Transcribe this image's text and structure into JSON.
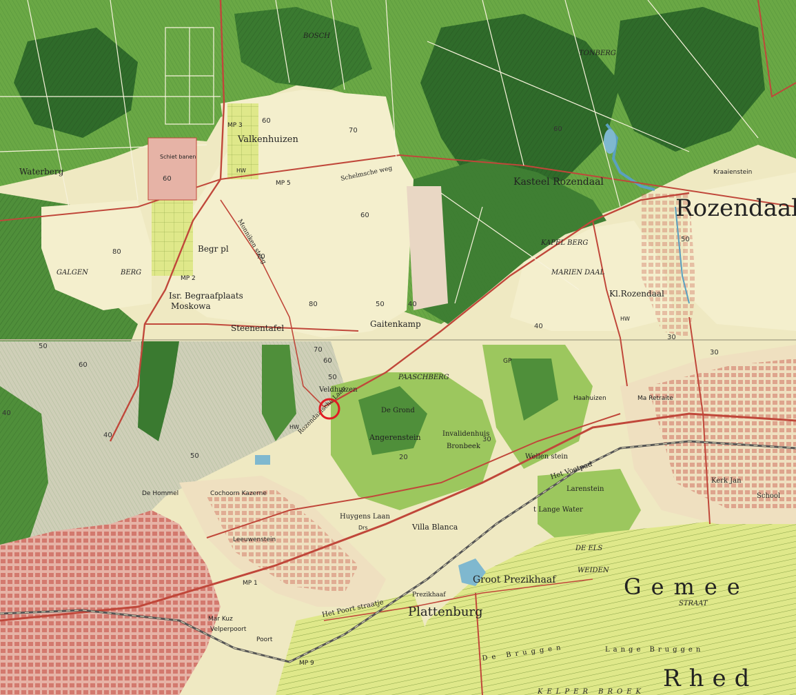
{
  "map": {
    "colors": {
      "forest_dark": "#2f6b2a",
      "forest": "#4f8f3a",
      "grass": "#a7cf63",
      "heath": "#f1ecc6",
      "meadow": "#dfe88a",
      "urban": "#d9958b",
      "road": "#c0473a",
      "rail": "#555555",
      "water": "#7fb8cf"
    },
    "place_labels": {
      "valkenhuizen": "Valkenhuizen",
      "waterberg": "Waterberg",
      "schietbanen": "Schiet banen",
      "galgenberg": "GALGEN",
      "berg": "BERG",
      "begrpl": "Begr pl",
      "isr_begraafplaats": "Isr. Begraafplaats",
      "moskowa": "Moskowa",
      "steenentafel": "Steenentafel",
      "gaitenkamp": "Gaitenkamp",
      "kasteel_rozendaal": "Kasteel Rozendaal",
      "rozendaal": "Rozendaal",
      "kl_rozendaal": "Kl.Rozendaal",
      "kapel_berg": "KAPEL BERG",
      "marien_daal": "MARIEN DAAL",
      "tonberg": "TONBERG",
      "bosch": "BOSCH",
      "paaschberg": "PAASCHBERG",
      "veldhuizen": "Veldhuizen",
      "de_grond": "De Grond",
      "angerenstein": "Angerenstein",
      "invalidenhuis": "Invalidenhuis",
      "bronbeek": "Bronbeek",
      "wellenstein": "Wellen stein",
      "het_voetpad": "Het Voetpad",
      "larenstein": "Larenstein",
      "villa_blanca": "Villa Blanca",
      "groot_prezikhaaf": "Groot Prezikhaaf",
      "plattenburg": "Plattenburg",
      "prezikhaaf": "Prezikhaaf",
      "de_els_weiden": "DE ELS",
      "weiden": "WEIDEN",
      "gemeente": "Gemee",
      "rhed": "Rhed",
      "straat": "STRAAT",
      "lange_water": "t Lange Water",
      "huygens_laan": "Huygens Laan",
      "cochoorn_kazerne": "Cochoorn Kazerne",
      "leeuwenstein": "Leeuwenstein",
      "mariendaal": "Mar Kuz",
      "velperpoort": "Velperpoort",
      "poort": "Poort",
      "het_poort_straatje": "Het Poort straatje",
      "de_bruggen": "De Bruggen",
      "lange_bruggen": "Lange Bruggen",
      "kelper_broek": "KELPER BROEK",
      "ma_retraite": "Ma Retraite",
      "haahuizen": "Haahuizen",
      "kerk_laan": "Kerk Jan",
      "school": "School",
      "kraaienstein": "Kraaienstein",
      "schelmsche_weg": "Schelmsche weg",
      "monnikensteeg": "Monniken steeg",
      "rozendaalsche_laan": "Rozendaalsche Laan",
      "de_hommel": "De Hommel",
      "mp1": "MP 1",
      "mp2": "MP 2",
      "mp3": "MP 3",
      "mp5": "MP 5",
      "mp9": "MP 9",
      "gp": "GP",
      "hw": "HW",
      "dr": "Drs"
    },
    "contour_labels": [
      "60",
      "70",
      "60",
      "80",
      "70",
      "80",
      "60",
      "50",
      "40",
      "60",
      "50",
      "40",
      "30",
      "70",
      "60",
      "50",
      "60",
      "40",
      "50",
      "40",
      "30",
      "20",
      "30",
      "50"
    ],
    "marker": {
      "color": "#e01b24",
      "label": ""
    }
  }
}
